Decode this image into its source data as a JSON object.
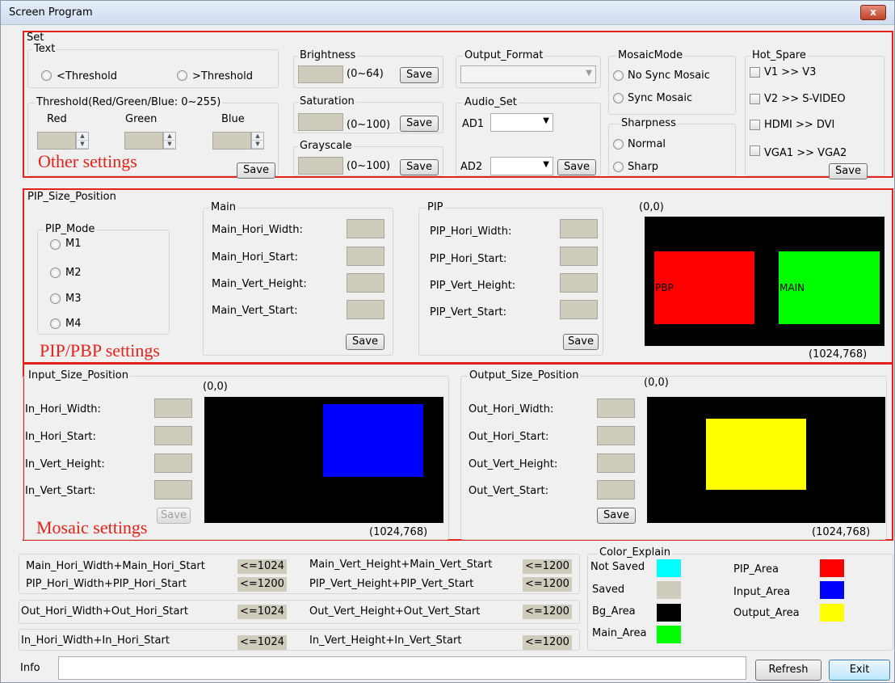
{
  "window": {
    "title": "Screen Program",
    "close": "x"
  },
  "set": {
    "group_label": "Set",
    "text": {
      "label": "Text",
      "radio_lt": "<Threshold",
      "radio_gt": ">Threshold"
    },
    "threshold": {
      "label": "Threshold(Red/Green/Blue: 0~255)",
      "red": "Red",
      "green": "Green",
      "blue": "Blue",
      "save": "Save"
    },
    "brightness": {
      "label": "Brightness",
      "range": "(0~64)",
      "save": "Save"
    },
    "saturation": {
      "label": "Saturation",
      "range": "(0~100)",
      "save": "Save"
    },
    "grayscale": {
      "label": "Grayscale",
      "range": "(0~100)",
      "save": "Save"
    },
    "output_format": {
      "label": "Output_Format"
    },
    "audio": {
      "label": "Audio_Set",
      "ad1": "AD1",
      "ad2": "AD2",
      "save": "Save"
    },
    "mosaic": {
      "label": "MosaicMode",
      "no_sync": "No Sync Mosaic",
      "sync": "Sync Mosaic"
    },
    "sharpness": {
      "label": "Sharpness",
      "normal": "Normal",
      "sharp": "Sharp"
    },
    "hot_spare": {
      "label": "Hot_Spare",
      "items": [
        "V1  >>  V3",
        "V2  >>  S-VIDEO",
        "HDMI  >>  DVI",
        "VGA1  >>  VGA2"
      ],
      "save": "Save"
    },
    "annotation": "Other settings"
  },
  "pip": {
    "label": "PIP_Size_Position",
    "mode": {
      "label": "PIP_Mode",
      "m1": "M1",
      "m2": "M2",
      "m3": "M3",
      "m4": "M4"
    },
    "main": {
      "label": "Main",
      "fields": [
        "Main_Hori_Width:",
        "Main_Hori_Start:",
        "Main_Vert_Height:",
        "Main_Vert_Start:"
      ],
      "save": "Save"
    },
    "pip_group": {
      "label": "PIP",
      "fields": [
        "PIP_Hori_Width:",
        "PIP_Hori_Start:",
        "PIP_Vert_Height:",
        "PIP_Vert_Start:"
      ],
      "save": "Save"
    },
    "preview": {
      "origin": "(0,0)",
      "end": "(1024,768)",
      "pbp_label": "PBP",
      "main_label": "MAIN"
    },
    "annotation": "PIP/PBP settings"
  },
  "input": {
    "label": "Input_Size_Position",
    "fields": [
      "In_Hori_Width:",
      "In_Hori_Start:",
      "In_Vert_Height:",
      "In_Vert_Start:"
    ],
    "save": "Save",
    "origin": "(0,0)",
    "end": "(1024,768)",
    "annotation": "Mosaic settings"
  },
  "output": {
    "label": "Output_Size_Position",
    "fields": [
      "Out_Hori_Width:",
      "Out_Hori_Start:",
      "Out_Vert_Height:",
      "Out_Vert_Start:"
    ],
    "save": "Save",
    "origin": "(0,0)",
    "end": "(1024,768)"
  },
  "constraints": {
    "row1": {
      "a": "Main_Hori_Width+Main_Hori_Start",
      "av": "<=1024",
      "b": "Main_Vert_Height+Main_Vert_Start",
      "bv": "<=1200"
    },
    "row2": {
      "a": "PIP_Hori_Width+PIP_Hori_Start",
      "av": "<=1200",
      "b": "PIP_Vert_Height+PIP_Vert_Start",
      "bv": "<=1200"
    },
    "row3": {
      "a": "Out_Hori_Width+Out_Hori_Start",
      "av": "<=1024",
      "b": "Out_Vert_Height+Out_Vert_Start",
      "bv": "<=1200"
    },
    "row4": {
      "a": "In_Hori_Width+In_Hori_Start",
      "av": "<=1024",
      "b": "In_Vert_Height+In_Vert_Start",
      "bv": "<=1200"
    }
  },
  "color_explain": {
    "label": "Color_Explain",
    "items": [
      {
        "name": "Not Saved",
        "color": "#00ffff"
      },
      {
        "name": "Saved",
        "color": "#cfccbd"
      },
      {
        "name": "Bg_Area",
        "color": "#000000"
      },
      {
        "name": "Main_Area",
        "color": "#00ff00"
      },
      {
        "name": "PIP_Area",
        "color": "#ff0000"
      },
      {
        "name": "Input_Area",
        "color": "#0000ff"
      },
      {
        "name": "Output_Area",
        "color": "#ffff00"
      }
    ]
  },
  "footer": {
    "info_label": "Info",
    "info_value": "",
    "refresh": "Refresh",
    "exit": "Exit"
  }
}
